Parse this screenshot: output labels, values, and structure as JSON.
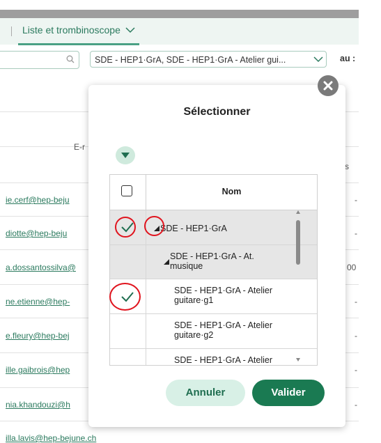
{
  "tabs": {
    "active_label": "Liste et trombinoscope"
  },
  "filters": {
    "search_placeholder": "",
    "group_select_value": "SDE - HEP1·GrA, SDE - HEP1·GrA - Atelier gui...",
    "au_label": "au :"
  },
  "background_table": {
    "email_header": "E-r",
    "col_s_header": "s",
    "emails": [
      "ie.cerf@hep-beju",
      "diotte@hep-beju",
      "a.dossantossilva@",
      "ne.etienne@hep-",
      "e.fleury@hep-bej",
      "ille.gaibrois@hep",
      "nia.khandouzi@h",
      "illa.lavis@hep-bejune.ch"
    ],
    "dash": "-",
    "partial_value": "00"
  },
  "modal": {
    "title": "Sélectionner",
    "column_header": "Nom",
    "rows": [
      {
        "label": "SDE - HEP1·GrA",
        "checked": true
      },
      {
        "label_line1": "SDE - HEP1·GrA - At.",
        "label_line2": "musique",
        "checked": false
      },
      {
        "label_line1": "SDE - HEP1·GrA - Atelier",
        "label_line2": "guitare·g1",
        "checked": true
      },
      {
        "label_line1": "SDE - HEP1·GrA - Atelier",
        "label_line2": "guitare·g2",
        "checked": false
      },
      {
        "label_line1": "SDE - HEP1·GrA - Atelier",
        "checked": false
      }
    ],
    "cancel_label": "Annuler",
    "confirm_label": "Valider"
  },
  "colors": {
    "accent": "#1a7a52",
    "accent_light": "#d8f0e6",
    "annotation_red": "#e0141e"
  },
  "icons": [
    "search-icon",
    "chevron-down-icon",
    "close-icon",
    "collapse-toggle-icon",
    "checkmark-icon",
    "expand-triangle-icon"
  ]
}
